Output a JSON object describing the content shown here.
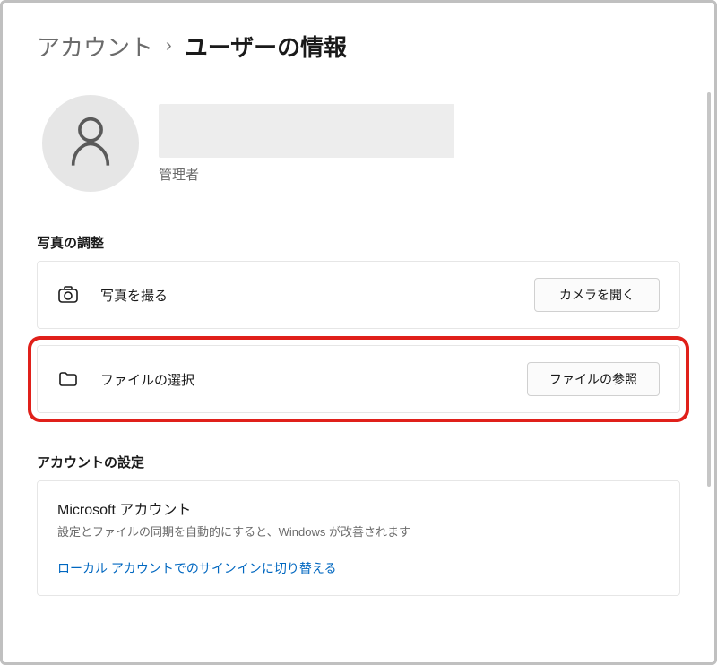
{
  "breadcrumb": {
    "parent": "アカウント",
    "current": "ユーザーの情報"
  },
  "profile": {
    "role": "管理者"
  },
  "sections": {
    "adjust_photo": {
      "title": "写真の調整",
      "take_photo": {
        "label": "写真を撮る",
        "button": "カメラを開く"
      },
      "choose_file": {
        "label": "ファイルの選択",
        "button": "ファイルの参照"
      }
    },
    "account_settings": {
      "title": "アカウントの設定",
      "ms_account": {
        "title": "Microsoft アカウント",
        "desc": "設定とファイルの同期を自動的にすると、Windows が改善されます",
        "link": "ローカル アカウントでのサインインに切り替える"
      }
    }
  }
}
